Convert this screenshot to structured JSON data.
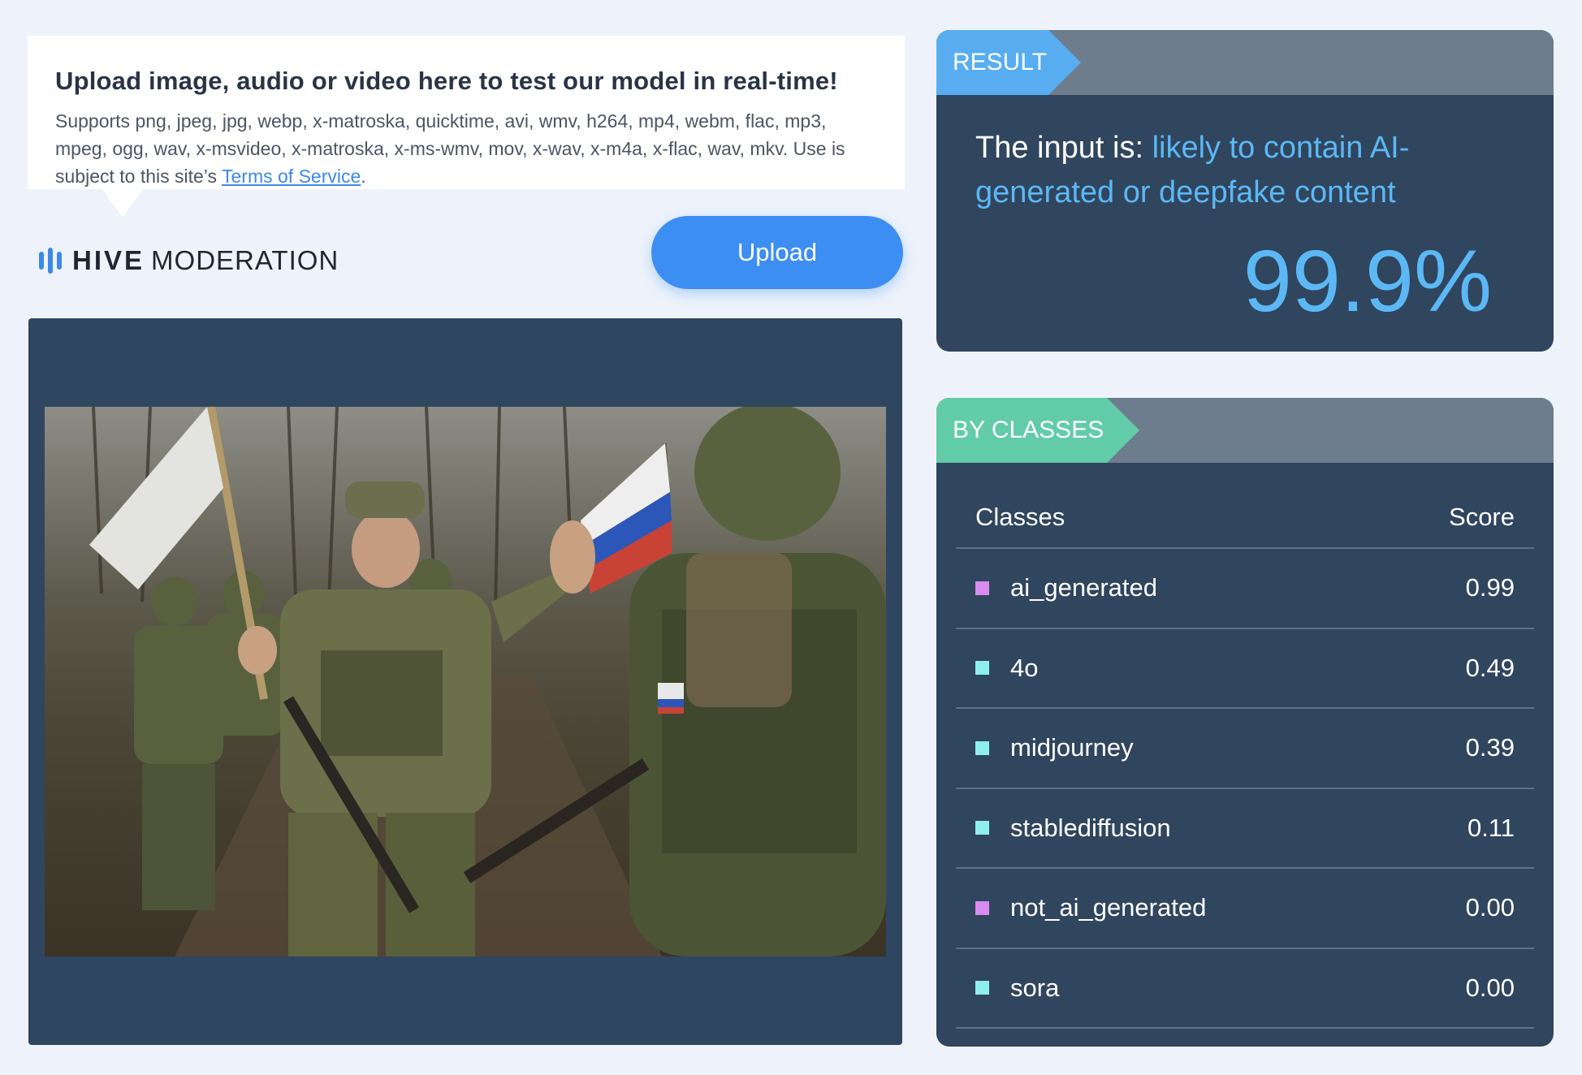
{
  "upload_info": {
    "title": "Upload image, audio or video here to test our model in real-time!",
    "supports_text": "Supports png, jpeg, jpg, webp, x-matroska, quicktime, avi, wmv, h264, mp4, webm, flac, mp3, mpeg, ogg, wav, x-msvideo, x-matroska, x-ms-wmv, mov, x-wav, x-m4a, x-flac, wav, mkv. Use is subject to this site’s",
    "terms_link": "Terms of Service",
    "terms_suffix": "."
  },
  "logo": {
    "brand": "HIVE",
    "product": "MODERATION"
  },
  "upload_button": {
    "label": "Upload"
  },
  "result": {
    "tag": "RESULT",
    "prefix": "The input is: ",
    "verdict": "likely to contain AI-generated or deepfake content",
    "percentage": "99.9%"
  },
  "classes": {
    "tag": "BY CLASSES",
    "header_class": "Classes",
    "header_score": "Score",
    "rows": [
      {
        "label": "ai_generated",
        "score": "0.99",
        "color": "#d88cf0"
      },
      {
        "label": "4o",
        "score": "0.49",
        "color": "#8ef0ec"
      },
      {
        "label": "midjourney",
        "score": "0.39",
        "color": "#8ef0ec"
      },
      {
        "label": "stablediffusion",
        "score": "0.11",
        "color": "#8ef0ec"
      },
      {
        "label": "not_ai_generated",
        "score": "0.00",
        "color": "#d88cf0"
      },
      {
        "label": "sora",
        "score": "0.00",
        "color": "#8ef0ec"
      }
    ]
  },
  "colors": {
    "accent_blue": "#3d8ef2",
    "result_tag": "#57adf0",
    "classes_tag": "#62cca8",
    "panel_bg": "#30455e",
    "panel_header": "#6d7d8d"
  }
}
